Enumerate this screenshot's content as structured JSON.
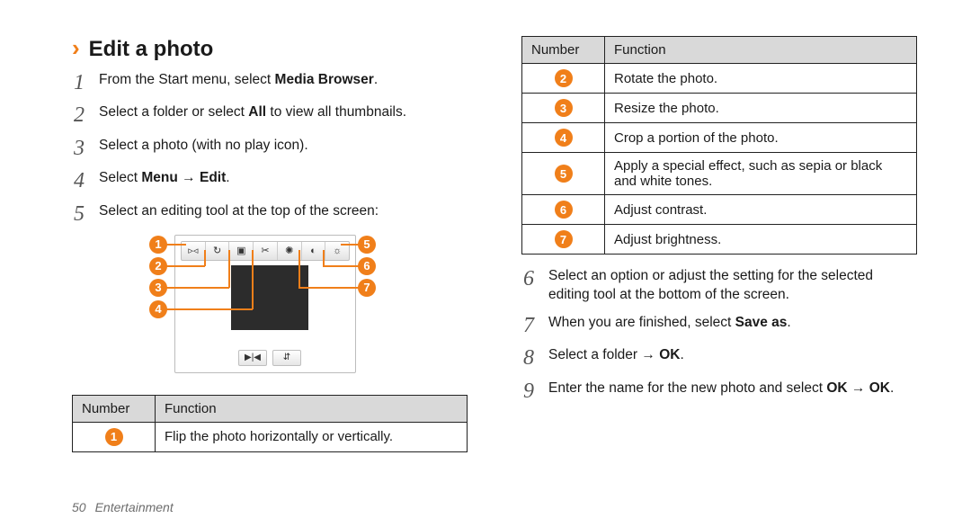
{
  "accent": "#f07f1a",
  "title": "Edit a photo",
  "steps_left": [
    {
      "n": "1",
      "html": "From the Start menu, select <b>Media Browser</b>."
    },
    {
      "n": "2",
      "html": "Select a folder or select <b>All</b> to view all thumbnails."
    },
    {
      "n": "3",
      "html": "Select a photo (with no play icon)."
    },
    {
      "n": "4",
      "html": "Select <b>Menu</b> → <b>Edit</b>."
    },
    {
      "n": "5",
      "html": "Select an editing tool at the top of the screen:"
    }
  ],
  "table_header": {
    "col1": "Number",
    "col2": "Function"
  },
  "table_left_rows": [
    {
      "n": "1",
      "html": "Flip the photo horizontally or vertically."
    }
  ],
  "table_right_rows": [
    {
      "n": "2",
      "html": "Rotate the photo."
    },
    {
      "n": "3",
      "html": "Resize the photo."
    },
    {
      "n": "4",
      "html": "Crop a portion of the photo."
    },
    {
      "n": "5",
      "html": "Apply a special effect, such as sepia or black and white tones."
    },
    {
      "n": "6",
      "html": "Adjust contrast."
    },
    {
      "n": "7",
      "html": "Adjust brightness."
    }
  ],
  "steps_right": [
    {
      "n": "6",
      "html": "Select an option or adjust the setting for the selected editing tool at the bottom of the screen."
    },
    {
      "n": "7",
      "html": "When you are finished, select <b>Save as</b>."
    },
    {
      "n": "8",
      "html": "Select a folder → <b>OK</b>."
    },
    {
      "n": "9",
      "html": "Enter the name for the new photo and select <b>OK</b> → <b>OK</b>."
    }
  ],
  "callouts": [
    "1",
    "2",
    "3",
    "4",
    "5",
    "6",
    "7"
  ],
  "icons": {
    "tool1": "▹◃",
    "tool2": "↻",
    "tool3": "▣",
    "tool4": "✂",
    "tool5": "✺",
    "tool6": "◐",
    "tool7": "☼",
    "ctrl1": "▶|◀",
    "ctrl2": "⇵"
  },
  "footer": {
    "page": "50",
    "section": "Entertainment"
  }
}
